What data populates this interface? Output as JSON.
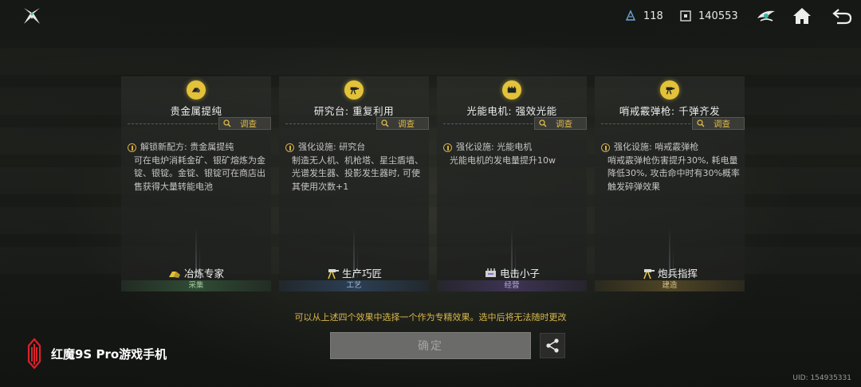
{
  "topbar": {
    "resource1": {
      "icon": "crystal-icon",
      "value": "118"
    },
    "resource2": {
      "icon": "chip-icon",
      "value": "140553"
    }
  },
  "cards": [
    {
      "icon": "gold-bars-icon",
      "title": "贵金属提纯",
      "inspect_label": "调查",
      "desc_head": "解锁新配方: 贵金属提纯",
      "desc_body": "可在电炉消耗金矿、银矿熔炼为金锭、银锭。金锭、银锭可在商店出售获得大量转能电池",
      "role": "冶炼专家",
      "category": "采集"
    },
    {
      "icon": "turret-icon",
      "title": "研究台: 重复利用",
      "inspect_label": "调查",
      "desc_head": "强化设施: 研究台",
      "desc_body": "制造无人机、机枪塔、星尘盾墙、光谱发生器、投影发生器时, 可使其使用次数+1",
      "role": "生产巧匠",
      "category": "工艺"
    },
    {
      "icon": "generator-icon",
      "title": "光能电机: 强效光能",
      "inspect_label": "调查",
      "desc_head": "强化设施: 光能电机",
      "desc_body": "光能电机的发电量提升10w",
      "role": "电击小子",
      "category": "经营"
    },
    {
      "icon": "turret-icon",
      "title": "哨戒霰弹枪: 千弹齐发",
      "inspect_label": "调查",
      "desc_head": "强化设施: 哨戒霰弹枪",
      "desc_body": "哨戒霰弹枪伤害提升30%, 耗电量降低30%, 攻击命中时有30%概率触发碎弹效果",
      "role": "炮兵指挥",
      "category": "建造"
    }
  ],
  "notice": "可以从上述四个效果中选择一个作为专精效果。选中后将无法随时更改",
  "confirm_label": "确定",
  "brand": "红魔9S Pro游戏手机",
  "uid": "UID: 154935331",
  "colors": {
    "accent_gold": "#d9b84a",
    "badge_yellow": "#e3c23a"
  }
}
